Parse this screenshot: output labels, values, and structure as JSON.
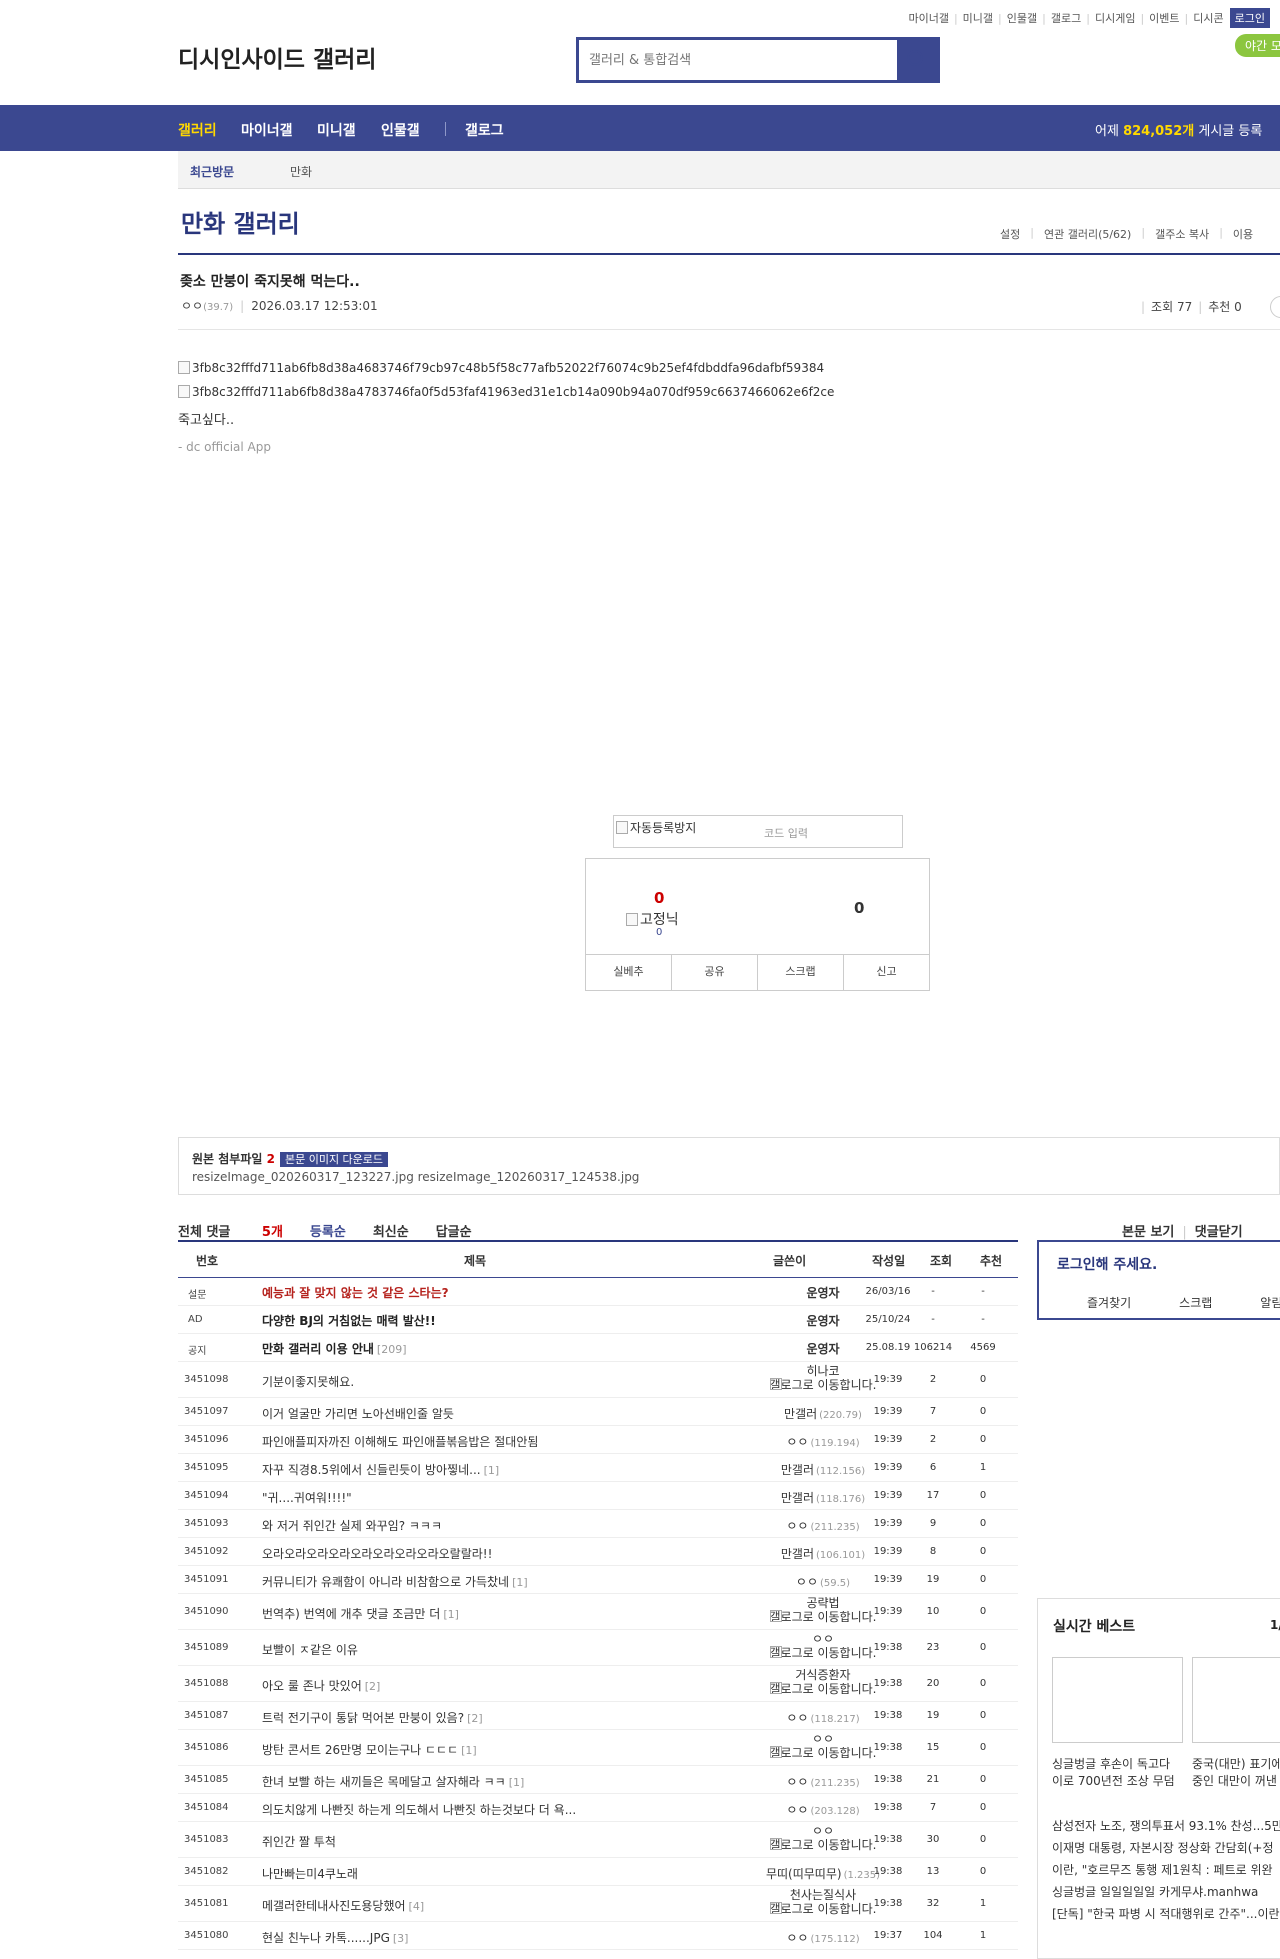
{
  "top_links": [
    "마이너갤",
    "미니갤",
    "인물갤",
    "갤로그",
    "디시게임",
    "이벤트",
    "디시콘"
  ],
  "login_label": "로그인",
  "night_label": "야간 모",
  "logo_alt": "디시인사이드 갤러리",
  "search": {
    "placeholder": "갤러리 & 통합검색"
  },
  "gnb": {
    "items": [
      "갤러리",
      "마이너갤",
      "미니갤",
      "인물갤",
      "갤로그"
    ],
    "stat_prefix": "어제",
    "stat_count": "824,052개",
    "stat_suffix": "게시글 등록"
  },
  "recent": {
    "label": "최근방문",
    "items": [
      "만화"
    ]
  },
  "gallery": {
    "title": "만화 갤러리",
    "options": [
      "설정",
      "연관 갤러리(5/62)",
      "갤주소 복사",
      "이용"
    ]
  },
  "post": {
    "title": "좆소 만붕이 죽지못해 먹는다..",
    "author": "ㅇㅇ",
    "author_ip": "(39.7)",
    "date": "2026.03.17 12:53:01",
    "views_label": "조회 77",
    "recommend_label": "추천 0",
    "images": [
      "3fb8c32fffd711ab6fb8d38a4683746f79cb97c48b5f58c77afb52022f76074c9b25ef4fdbddfa96dafbf59384",
      "3fb8c32fffd711ab6fb8d38a4783746fa0f5d53faf41963ed31e1cb14a090b94a070df959c6637466062e6f2ce"
    ],
    "body": "죽고싶다..",
    "signature": "- dc official App"
  },
  "captcha": {
    "alt": "자동등록방지",
    "placeholder": "코드 입력"
  },
  "vote": {
    "up": "0",
    "fix_label": "고정닉",
    "fix_count": "0",
    "down": "0",
    "buttons": [
      "실베추",
      "공유",
      "스크랩",
      "신고"
    ]
  },
  "attach": {
    "label": "원본 첨부파일",
    "count": "2",
    "download": "본문 이미지 다운로드",
    "files": "resizeImage_020260317_123227.jpg  resizeImage_120260317_124538.jpg"
  },
  "comments_tabs": {
    "all": "전체 댓글",
    "count": "5개",
    "tabs": [
      "등록순",
      "최신순",
      "답글순"
    ],
    "right": [
      "본문 보기",
      "댓글닫기"
    ]
  },
  "list_header": {
    "num": "번호",
    "title": "제목",
    "writer": "글쓴이",
    "date": "작성일",
    "views": "조회",
    "rec": "추천"
  },
  "notices": [
    {
      "num": "설문",
      "title": "예능과 잘 맞지 않는 것 같은 스타는?",
      "writer": "운영자",
      "date": "26/03/16",
      "views": "-",
      "rec": "-",
      "color": "#b5221d"
    },
    {
      "num": "AD",
      "title": "다양한 BJ의 거침없는 매력 발산!!",
      "writer": "운영자",
      "date": "25/10/24",
      "views": "-",
      "rec": "-",
      "color": "#222222"
    },
    {
      "num": "공지",
      "title": "만화 갤러리 이용 안내",
      "reply": "[209]",
      "writer": "운영자",
      "date": "25.08.19",
      "views": "106214",
      "rec": "4569",
      "color": "#222222"
    }
  ],
  "rows": [
    {
      "num": "3451098",
      "title": "기분이좋지못해요.",
      "reply": "",
      "writer": "히나코",
      "img": "갤로그로 이동합니다.",
      "ip": "",
      "date": "19:39",
      "views": "2",
      "rec": "0"
    },
    {
      "num": "3451097",
      "title": "이거 얼굴만 가리면 노아선배인줄 알듯",
      "reply": "",
      "writer": "만갤러",
      "img": "",
      "ip": "(220.79)",
      "date": "19:39",
      "views": "7",
      "rec": "0"
    },
    {
      "num": "3451096",
      "title": "파인애플피자까진 이해해도 파인애플볶음밥은 절대안됨",
      "reply": "",
      "writer": "ㅇㅇ",
      "img": "",
      "ip": "(119.194)",
      "date": "19:39",
      "views": "2",
      "rec": "0"
    },
    {
      "num": "3451095",
      "title": "자꾸 직경8.5위에서 신들린듯이 방아찧네...",
      "reply": "[1]",
      "writer": "만갤러",
      "img": "",
      "ip": "(112.156)",
      "date": "19:39",
      "views": "6",
      "rec": "1"
    },
    {
      "num": "3451094",
      "title": "\"귀....귀여워!!!!\"",
      "reply": "",
      "writer": "만갤러",
      "img": "",
      "ip": "(118.176)",
      "date": "19:39",
      "views": "17",
      "rec": "0"
    },
    {
      "num": "3451093",
      "title": "와 저거 쥐인간 실제 와꾸임? ㅋㅋㅋ",
      "reply": "",
      "writer": "ㅇㅇ",
      "img": "",
      "ip": "(211.235)",
      "date": "19:39",
      "views": "9",
      "rec": "0"
    },
    {
      "num": "3451092",
      "title": "오라오라오라오라오라오라오라오라오랄랄라!!",
      "reply": "",
      "writer": "만갤러",
      "img": "",
      "ip": "(106.101)",
      "date": "19:39",
      "views": "8",
      "rec": "0"
    },
    {
      "num": "3451091",
      "title": "커뮤니티가 유쾌함이 아니라 비참함으로 가득찼네",
      "reply": "[1]",
      "writer": "ㅇㅇ",
      "img": "",
      "ip": "(59.5)",
      "date": "19:39",
      "views": "19",
      "rec": "0"
    },
    {
      "num": "3451090",
      "title": "번역추) 번역에 개추 댓글 조금만 더",
      "reply": "[1]",
      "writer": "공략법",
      "img": "갤로그로 이동합니다.",
      "ip": "",
      "date": "19:39",
      "views": "10",
      "rec": "0"
    },
    {
      "num": "3451089",
      "title": "보빨이 ㅈ같은 이유",
      "reply": "",
      "writer": "ㅇㅇ",
      "img": "갤로그로 이동합니다.",
      "ip": "",
      "date": "19:38",
      "views": "23",
      "rec": "0"
    },
    {
      "num": "3451088",
      "title": "아오 룰 존나 맛있어",
      "reply": "[2]",
      "writer": "거식증환자",
      "img": "갤로그로 이동합니다.",
      "ip": "",
      "date": "19:38",
      "views": "20",
      "rec": "0"
    },
    {
      "num": "3451087",
      "title": "트럭 전기구이 통닭 먹어본 만붕이 있음?",
      "reply": "[2]",
      "writer": "ㅇㅇ",
      "img": "",
      "ip": "(118.217)",
      "date": "19:38",
      "views": "19",
      "rec": "0"
    },
    {
      "num": "3451086",
      "title": "방탄 콘서트 26만명 모이는구나 ㄷㄷㄷ",
      "reply": "[1]",
      "writer": "ㅇㅇ",
      "img": "갤로그로 이동합니다.",
      "ip": "",
      "date": "19:38",
      "views": "15",
      "rec": "0"
    },
    {
      "num": "3451085",
      "title": "한녀 보빨 하는 새끼들은 목메달고 살자해라 ㅋㅋ",
      "reply": "[1]",
      "writer": "ㅇㅇ",
      "img": "",
      "ip": "(211.235)",
      "date": "19:38",
      "views": "21",
      "rec": "0"
    },
    {
      "num": "3451084",
      "title": "의도치않게 나빤짓 하는게 의도해서 나빤짓 하는것보다 더 욕...",
      "reply": "",
      "writer": "ㅇㅇ",
      "img": "",
      "ip": "(203.128)",
      "date": "19:38",
      "views": "7",
      "rec": "0"
    },
    {
      "num": "3451083",
      "title": "쥐인간 짤 투척",
      "reply": "",
      "writer": "ㅇㅇ",
      "img": "갤로그로 이동합니다.",
      "ip": "",
      "date": "19:38",
      "views": "30",
      "rec": "0"
    },
    {
      "num": "3451082",
      "title": "나만빠는미4쿠노래",
      "reply": "",
      "writer": "무띠(띠무띠무)",
      "img": "",
      "ip": "(1.235)",
      "date": "19:38",
      "views": "13",
      "rec": "0"
    },
    {
      "num": "3451081",
      "title": "메갤러한테내사진도용당했어",
      "reply": "[4]",
      "writer": "천사는질식사",
      "img": "갤로그로 이동합니다.",
      "ip": "",
      "date": "19:38",
      "views": "32",
      "rec": "1"
    },
    {
      "num": "3451080",
      "title": "현실 친누나 카톡......JPG",
      "reply": "[3]",
      "writer": "ㅇㅇ",
      "img": "",
      "ip": "(175.112)",
      "date": "19:37",
      "views": "104",
      "rec": "1"
    }
  ],
  "sidebar": {
    "login_prompt": "로그인해 주세요.",
    "links": [
      "즐겨찾기",
      "스크랩",
      "알림"
    ]
  },
  "best": {
    "title": "실시간 베스트",
    "page": "1/",
    "captions": [
      "싱글벙글 후손이 독고다\n이로 700년전 조상 무덤",
      "중국(대만) 표기에\n중인 대만이 꺼낸"
    ],
    "items": [
      "삼성전자 노조, 쟁의투표서 93.1% 찬성...5만",
      "이재명 대통령, 자본시장 정상화 간담회(+정",
      "이란, \"호르무즈 통행 제1원칙 : 페트로 위완",
      "싱글벙글 일일일일일 카게무샤.manhwa",
      "[단독] \"한국 파병 시 적대행위로 간주\"...이란"
    ]
  },
  "colors": {
    "brand": "#3b4890",
    "accent": "#ffd800",
    "danger": "#cc0000"
  }
}
